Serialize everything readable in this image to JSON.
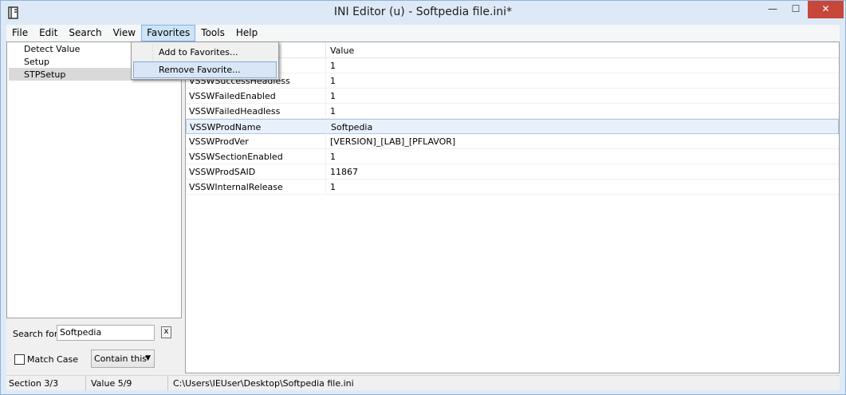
{
  "window": {
    "title": "INI Editor (u) - Softpedia file.ini*",
    "icon": "app-icon",
    "minimize_glyph": "—",
    "maximize_glyph": "☐",
    "close_glyph": "✕"
  },
  "menubar": {
    "items": [
      "File",
      "Edit",
      "Search",
      "View",
      "Favorites",
      "Tools",
      "Help"
    ],
    "active": "Favorites"
  },
  "favorites_menu": {
    "items": [
      "Add to Favorites...",
      "Remove Favorite..."
    ],
    "highlighted": "Remove Favorite..."
  },
  "sections": {
    "items": [
      "Detect Value",
      "Setup",
      "STPSetup"
    ],
    "selected": "STPSetup"
  },
  "search": {
    "label": "Search for",
    "value": "Softpedia",
    "clear_label": "x",
    "match_case_label": "Match Case",
    "match_case_checked": false,
    "mode": "Contain this"
  },
  "grid": {
    "columns": [
      "",
      "Value"
    ],
    "rows": [
      {
        "key": "",
        "value": "1"
      },
      {
        "key": "VSSWSuccessHeadless",
        "value": "1"
      },
      {
        "key": "VSSWFailedEnabled",
        "value": "1"
      },
      {
        "key": "VSSWFailedHeadless",
        "value": "1"
      },
      {
        "key": "VSSWProdName",
        "value": "Softpedia"
      },
      {
        "key": "VSSWProdVer",
        "value": "[VERSION]_[LAB]_[PFLAVOR]"
      },
      {
        "key": "VSSWSectionEnabled",
        "value": "1"
      },
      {
        "key": "VSSWProdSAID",
        "value": "11867"
      },
      {
        "key": "VSSWInternalRelease",
        "value": "1"
      }
    ],
    "selected_row": 4
  },
  "status": {
    "section": "Section 3/3",
    "value": "Value 5/9",
    "path": "C:\\Users\\IEUser\\Desktop\\Softpedia file.ini"
  }
}
